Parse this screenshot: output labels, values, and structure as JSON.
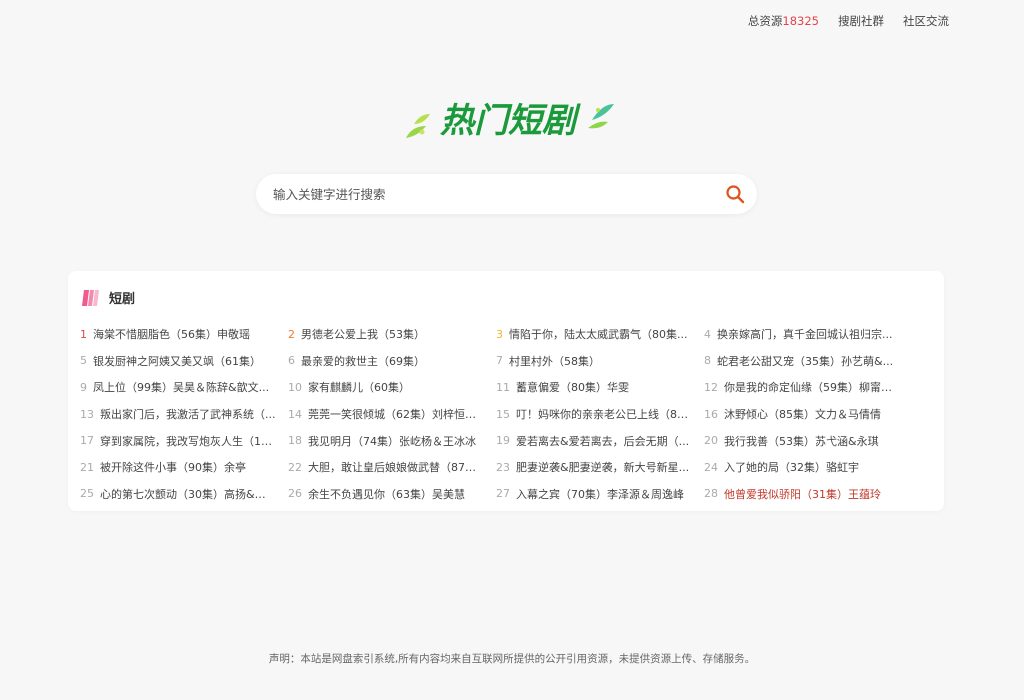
{
  "header": {
    "total_label": "总资源",
    "total_count": "18325",
    "links": [
      "搜剧社群",
      "社区交流"
    ]
  },
  "logo": {
    "text": "热门短剧",
    "color": "#1a9a3a"
  },
  "search": {
    "placeholder": "输入关键字进行搜索",
    "value": "",
    "icon": "search-icon",
    "icon_color": "#e0541f"
  },
  "section": {
    "title": "短剧",
    "icon": "bookmark-stripes-icon",
    "items": [
      {
        "num": "1",
        "title": "海棠不惜胭脂色（56集）申敬瑶"
      },
      {
        "num": "2",
        "title": "男德老公爱上我（53集）"
      },
      {
        "num": "3",
        "title": "情陷于你，陆太太威武霸气（80集..."
      },
      {
        "num": "4",
        "title": "换亲嫁高门，真千金回城认祖归宗..."
      },
      {
        "num": "5",
        "title": "银发厨神之阿姨又美又飒（61集）"
      },
      {
        "num": "6",
        "title": "最亲爱的救世主（69集）"
      },
      {
        "num": "7",
        "title": "村里村外（58集）"
      },
      {
        "num": "8",
        "title": "蛇君老公甜又宠（35集）孙艺萌&..."
      },
      {
        "num": "9",
        "title": "凤上位（99集）吴昊＆陈辞&歆文..."
      },
      {
        "num": "10",
        "title": "家有麒麟儿（60集）"
      },
      {
        "num": "11",
        "title": "蓄意偏爱（80集）华雯"
      },
      {
        "num": "12",
        "title": "你是我的命定仙缘（59集）柳甯&..."
      },
      {
        "num": "13",
        "title": "叛出家门后，我激活了武神系统（..."
      },
      {
        "num": "14",
        "title": "莞莞一笑很倾城（62集）刘梓恒&..."
      },
      {
        "num": "15",
        "title": "叮！妈咪你的亲亲老公已上线（83..."
      },
      {
        "num": "16",
        "title": "沐野倾心（85集）文力＆马倩倩"
      },
      {
        "num": "17",
        "title": "穿到家属院，我改写炮灰人生（11..."
      },
      {
        "num": "18",
        "title": "我见明月（74集）张屹杨＆王冰冰"
      },
      {
        "num": "19",
        "title": "爱若离去&爱若离去，后会无期（..."
      },
      {
        "num": "20",
        "title": "我行我善（53集）苏弋涵&永琪"
      },
      {
        "num": "21",
        "title": "被开除这件小事（90集）余亭"
      },
      {
        "num": "22",
        "title": "大胆，敢让皇后娘娘做武替（87集..."
      },
      {
        "num": "23",
        "title": "肥妻逆袭&肥妻逆袭，新大号新星..."
      },
      {
        "num": "24",
        "title": "入了她的局（32集）骆虹宇"
      },
      {
        "num": "25",
        "title": "心的第七次颤动（30集）高扬&李..."
      },
      {
        "num": "26",
        "title": "余生不负遇见你（63集）吴美慧"
      },
      {
        "num": "27",
        "title": "入幕之宾（70集）李泽源＆周逸峰"
      },
      {
        "num": "28",
        "title": "他曾爱我似骄阳（31集）王蕴玲"
      }
    ]
  },
  "footer": {
    "text": "声明：本站是网盘索引系统,所有内容均来自互联网所提供的公开引用资源，未提供资源上传、存储服务。"
  }
}
